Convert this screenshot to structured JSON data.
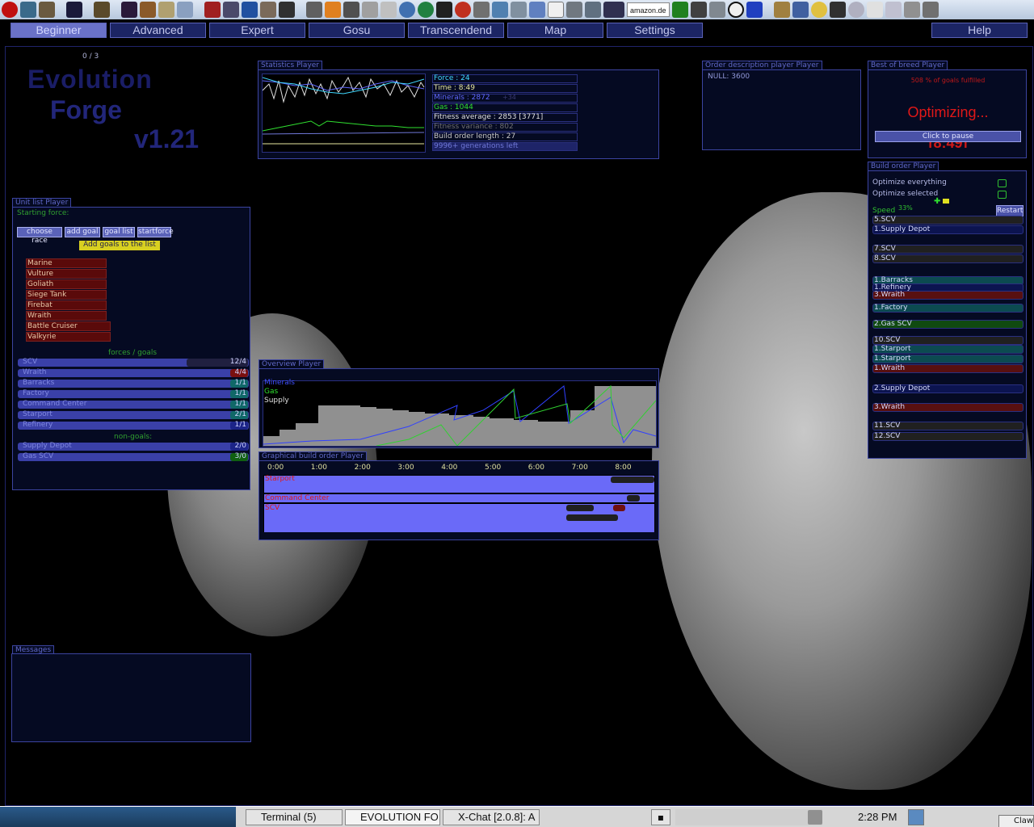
{
  "menu": {
    "items": [
      "Beginner",
      "Advanced",
      "Expert",
      "Gosu",
      "Transcendend",
      "Map",
      "Settings"
    ],
    "help": "Help"
  },
  "logo": {
    "line1": "Evolution",
    "line2": "Forge",
    "line3": "v1.21",
    "counter": "0 / 3"
  },
  "stats_panel": {
    "title": "Statistics Player",
    "lines": [
      {
        "text": "Force : 24",
        "color": "#40d8ff"
      },
      {
        "text": "Time : 8:49",
        "color": "#e8e8a0"
      },
      {
        "text": "Minerals : 2872",
        "color": "#6068ff"
      },
      {
        "text": "Gas : 1044",
        "color": "#30e030"
      },
      {
        "text": "Fitness average : 2853 [3771]",
        "color": "#e0e0e0"
      },
      {
        "text": "Fitness variance : 802",
        "color": "#707070"
      },
      {
        "text": "Build order length : 27",
        "color": "#c8c8c8"
      },
      {
        "text": "9996+ generations left",
        "color": "#7078d8"
      }
    ],
    "minerals_delta": "+34"
  },
  "order_panel": {
    "title": "Order description player Player",
    "text": "NULL: 3600"
  },
  "breed_panel": {
    "title": "Best of breed Player",
    "goals_text": "508 % of goals fulfilled",
    "status": "Optimizing...",
    "pause_button": "Click to pause",
    "hidden_timer": "[8:49]"
  },
  "build_order_panel": {
    "title": "Build order Player",
    "opt_everything": "Optimize everything",
    "opt_selected": "Optimize selected",
    "speed_label": "Speed",
    "speed_value": "33%",
    "restart_button": "Restart",
    "items": [
      {
        "text": "5.SCV",
        "color": "#202020"
      },
      {
        "text": "1.Supply Depot",
        "color": "#0c1450"
      },
      {
        "text": "7.SCV",
        "color": "#202020"
      },
      {
        "text": "8.SCV",
        "color": "#202020"
      },
      {
        "text": "1.Barracks",
        "color": "#0c4a50"
      },
      {
        "text": "1.Refinery",
        "color": "#0c1450"
      },
      {
        "text": "3.Wraith",
        "color": "#581010"
      },
      {
        "text": "1.Factory",
        "color": "#0c4a50"
      },
      {
        "text": "2.Gas SCV",
        "color": "#104a10"
      },
      {
        "text": "10.SCV",
        "color": "#202020"
      },
      {
        "text": "1.Starport",
        "color": "#0c4a50"
      },
      {
        "text": "1.Starport",
        "color": "#0c4a50"
      },
      {
        "text": "1.Wraith",
        "color": "#581010"
      },
      {
        "text": "2.Supply Depot",
        "color": "#0c1450"
      },
      {
        "text": "3.Wraith",
        "color": "#581010"
      },
      {
        "text": "11.SCV",
        "color": "#202020"
      },
      {
        "text": "12.SCV",
        "color": "#202020"
      }
    ]
  },
  "unit_panel": {
    "title": "Unit list Player",
    "starting_force": "Starting force:",
    "buttons": [
      "choose race",
      "add goal",
      "goal list",
      "startforce"
    ],
    "add_goals_button": "Add goals to the list",
    "units": [
      "Marine",
      "Vulture",
      "Goliath",
      "Siege Tank",
      "Firebat",
      "Wraith",
      "Battle Cruiser",
      "Valkyrie"
    ],
    "forces_goals_label": "forces / goals",
    "goals": [
      {
        "name": "SCV",
        "value": "12/4",
        "color": "#202040"
      },
      {
        "name": "Wraith",
        "value": "4/4",
        "color": "#7a1010"
      },
      {
        "name": "Barracks",
        "value": "1/1",
        "color": "#106868"
      },
      {
        "name": "Factory",
        "value": "1/1",
        "color": "#106868"
      },
      {
        "name": "Command Center",
        "value": "1/1",
        "color": "#106868"
      },
      {
        "name": "Starport",
        "value": "2/1",
        "color": "#106868"
      },
      {
        "name": "Refinery",
        "value": "1/1",
        "color": "#1c2488"
      }
    ],
    "non_goals_label": "non-goals:",
    "non_goals": [
      {
        "name": "Supply Depot",
        "value": "2/0",
        "color": "#1c2488"
      },
      {
        "name": "Gas SCV",
        "value": "3/0",
        "color": "#106010"
      }
    ]
  },
  "overview_panel": {
    "title": "Overview Player",
    "legend": [
      {
        "text": "Minerals",
        "color": "#4050ff"
      },
      {
        "text": "Gas",
        "color": "#30e030"
      },
      {
        "text": "Supply",
        "color": "#e0e0e0"
      }
    ]
  },
  "graphical_panel": {
    "title": "Graphical build order Player",
    "times": [
      "0:00",
      "1:00",
      "2:00",
      "3:00",
      "4:00",
      "5:00",
      "6:00",
      "7:00",
      "8:00"
    ],
    "rows": [
      "Starport",
      "Command Center",
      "SCV"
    ]
  },
  "messages_panel": {
    "title": "Messages"
  },
  "taskbar": {
    "tasks": [
      "Terminal (5)",
      "EVOLUTION FO",
      "X-Chat [2.0.8]: A"
    ],
    "clock": "2:28 PM",
    "corner": "Claw"
  },
  "topbar": {
    "amazon": "amazon.de"
  }
}
